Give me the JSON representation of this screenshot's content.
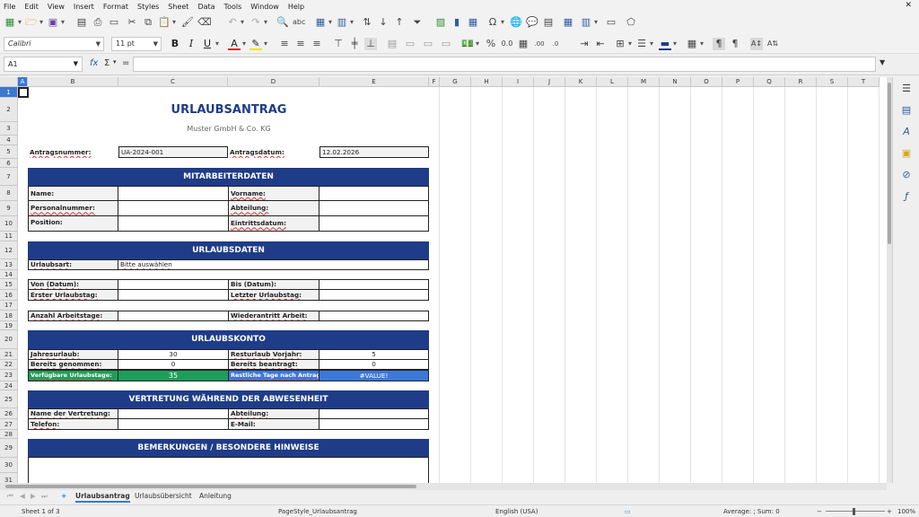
{
  "menu": [
    "File",
    "Edit",
    "View",
    "Insert",
    "Format",
    "Styles",
    "Sheet",
    "Data",
    "Tools",
    "Window",
    "Help"
  ],
  "font": {
    "name": "Calibri",
    "size": "11 pt"
  },
  "name_box": "A1",
  "formula_symbols": {
    "fx": "fx",
    "sum": "Σ",
    "eq": "="
  },
  "columns": [
    "A",
    "B",
    "C",
    "D",
    "E",
    "F",
    "G",
    "H",
    "I",
    "J",
    "K",
    "L",
    "M",
    "N",
    "O",
    "P",
    "Q",
    "R",
    "S",
    "T"
  ],
  "rows": [
    "1",
    "2",
    "3",
    "4",
    "5",
    "6",
    "7",
    "8",
    "9",
    "10",
    "11",
    "12",
    "13",
    "14",
    "15",
    "16",
    "17",
    "18",
    "19",
    "20",
    "21",
    "22",
    "23",
    "24",
    "25",
    "26",
    "27",
    "28",
    "29",
    "30",
    "31"
  ],
  "form": {
    "title": "URLAUBSANTRAG",
    "company": "Muster GmbH & Co. KG",
    "antragsnummer_label": "Antragsnummer:",
    "antragsnummer_value": "UA-2024-001",
    "antragsdatum_label": "Antragsdatum:",
    "antragsdatum_value": "12.02.2026",
    "sec_mitarbeiter": "MITARBEITERDATEN",
    "name_label": "Name:",
    "vorname_label": "Vorname:",
    "personalnummer_label": "Personalnummer:",
    "abteilung_label": "Abteilung:",
    "position_label": "Position:",
    "eintrittsdatum_label": "Eintrittsdatum:",
    "sec_urlaub": "URLAUBSDATEN",
    "urlaubsart_label": "Urlaubsart:",
    "urlaubsart_value": "Bitte auswählen",
    "von_label": "Von (Datum):",
    "bis_label": "Bis (Datum):",
    "erster_label": "Erster Urlaubstag:",
    "letzter_label": "Letzter Urlaubstag:",
    "anzahl_label": "Anzahl Arbeitstage:",
    "wiederantritt_label": "Wiederantritt Arbeit:",
    "sec_konto": "URLAUBSKONTO",
    "jahresurlaub_label": "Jahresurlaub:",
    "jahresurlaub_value": "30",
    "resturlaub_label": "Resturlaub Vorjahr:",
    "resturlaub_value": "5",
    "genommen_label": "Bereits genommen:",
    "genommen_value": "0",
    "beantragt_label": "Bereits beantragt:",
    "beantragt_value": "0",
    "verfuegbar_label": "Verfügbare Urlaubstage:",
    "verfuegbar_value": "35",
    "restliche_label": "Restliche Tage nach Antrag:",
    "restliche_value": "#VALUE!",
    "sec_vertretung": "VERTRETUNG WÄHREND DER ABWESENHEIT",
    "vertretung_label": "Name der Vertretung:",
    "vertretung_abteilung_label": "Abteilung:",
    "telefon_label": "Telefon:",
    "email_label": "E-Mail:",
    "sec_bemerkungen": "BEMERKUNGEN / BESONDERE HINWEISE"
  },
  "sheet_tabs": [
    "Urlaubsantrag",
    "Urlaubsübersicht",
    "Anleitung"
  ],
  "status": {
    "sheet": "Sheet 1 of 3",
    "page_style": "PageStyle_Urlaubsantrag",
    "language": "English (USA)",
    "summary": "Average: ; Sum: 0",
    "zoom": "100%"
  },
  "colors": {
    "section_header": "#1f3c88",
    "green_cell": "#1e9e5a",
    "blue_cell": "#3c78d8"
  }
}
